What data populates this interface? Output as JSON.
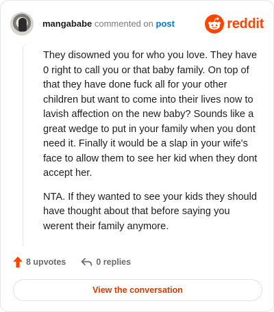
{
  "header": {
    "username": "mangababe",
    "action_text": "commented on",
    "target_link": "post",
    "brand_name": "reddit",
    "brand_color": "#ff4500",
    "link_color": "#0079d3"
  },
  "comment": {
    "paragraphs": [
      "They disowned you for who you love. They have 0 right to call you or that baby family. On top of that they have done fuck all for your other children but want to come into their lives now to lavish affection on the new baby? Sounds like a great wedge to put in your family when you dont need it. Finally it would be a slap in your wife's face to allow them to see her kid when they dont accept her.",
      "NTA. If they wanted to see your kids they should have thought about that before saying you werent their family anymore."
    ]
  },
  "actions": {
    "upvotes_label": "8 upvotes",
    "upvote_icon": "upvote-arrow-icon",
    "upvote_color": "#ff4500",
    "replies_label": "0 replies",
    "reply_icon": "reply-arrow-icon"
  },
  "cta": {
    "label": "View the conversation",
    "color": "#d93a00"
  }
}
